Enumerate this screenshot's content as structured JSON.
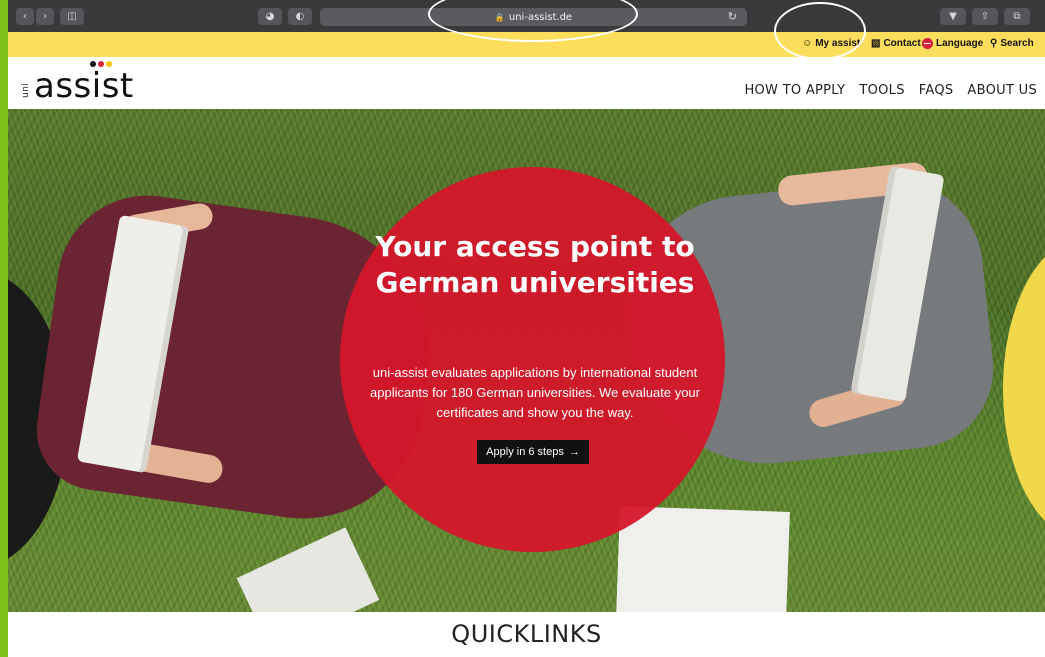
{
  "browser": {
    "url": "uni-assist.de"
  },
  "servicebar": {
    "my_assist": "My assist",
    "contact": "Contact",
    "language": "Language",
    "search": "Search"
  },
  "logo": {
    "small": "uni",
    "word": "assist",
    "dot_colors": [
      "#111111",
      "#d8203a",
      "#f5c400"
    ]
  },
  "nav": {
    "items": [
      "HOW TO APPLY",
      "TOOLS",
      "FAQS",
      "ABOUT US"
    ]
  },
  "hero": {
    "title": "Your access point to German universities",
    "text": "uni-assist evaluates applications by international student applicants for 180 German universities. We evaluate your certificates and show you the way.",
    "button": "Apply in 6 steps",
    "accent_color": "#d6152a"
  },
  "quicklinks": {
    "heading": "QUICKLINKS"
  },
  "colors": {
    "servicebar": "#fdde5c",
    "frame": "#7fc21b"
  }
}
